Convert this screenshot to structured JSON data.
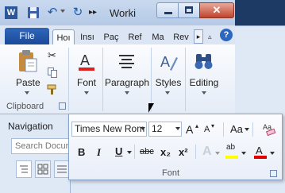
{
  "window": {
    "title": "Worki",
    "app_icon_letter": "W",
    "close_glyph": "✕"
  },
  "quick_access": {
    "more": "▸▸"
  },
  "tabs": {
    "file": "File",
    "items": [
      "Hoı",
      "Insı",
      "Paç",
      "Ref",
      "Ma",
      "Rev"
    ],
    "more": "▸",
    "collapse": "▵",
    "help": "?"
  },
  "ribbon": {
    "clipboard": {
      "paste_label": "Paste",
      "group_label": "Clipboard"
    },
    "font_button_label": "Font",
    "paragraph_button_label": "Paragraph",
    "styles_button_label": "Styles",
    "editing_button_label": "Editing"
  },
  "navigation": {
    "title": "Navigation",
    "search_placeholder": "Search Docum"
  },
  "font_popup": {
    "font_name": "Times New Rom",
    "font_size": "12",
    "grow": "A",
    "shrink": "A",
    "change_case": "Aa",
    "bold": "B",
    "italic": "I",
    "underline": "U",
    "strikethrough": "abc",
    "subscript": "x₂",
    "superscript": "x²",
    "text_effects": "A",
    "highlight": "ab",
    "font_color": "A",
    "group_label": "Font"
  },
  "colors": {
    "highlight": "#ffff00",
    "font_color": "#e00000",
    "file_tab": "#2b5fb0"
  }
}
